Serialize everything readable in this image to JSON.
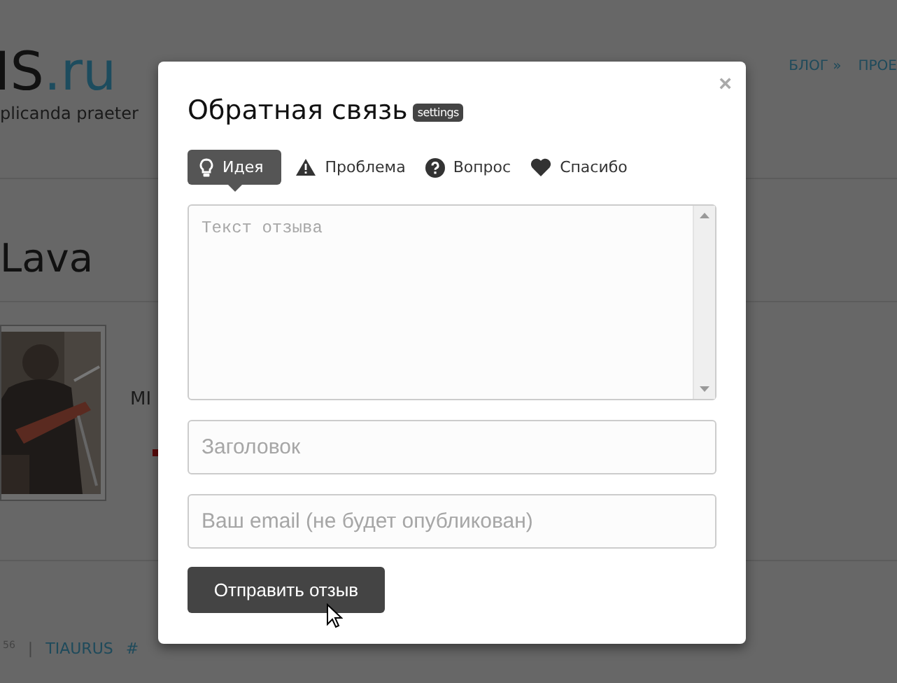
{
  "background_page": {
    "logo": {
      "main": "IS",
      "suffix": ".ru"
    },
    "tagline": "plicanda praeter",
    "nav": [
      "БЛОГ »",
      "ПРОЕ"
    ],
    "heading": "Lava",
    "caption": "MI",
    "footer": {
      "number": "56",
      "separator": "|",
      "tag": "TIAURUS",
      "hash": "#"
    }
  },
  "dialog": {
    "title": "Обратная связь",
    "badge": "settings",
    "close": "×",
    "tabs": [
      {
        "label": "Идея",
        "selected": true
      },
      {
        "label": "Проблема",
        "selected": false
      },
      {
        "label": "Вопрос",
        "selected": false
      },
      {
        "label": "Спасибо",
        "selected": false
      }
    ],
    "message": {
      "placeholder": "Текст отзыва"
    },
    "subject": {
      "placeholder": "Заголовок"
    },
    "email": {
      "placeholder": "Ваш email (не будет опубликован)"
    },
    "submit": "Отправить отзыв"
  }
}
